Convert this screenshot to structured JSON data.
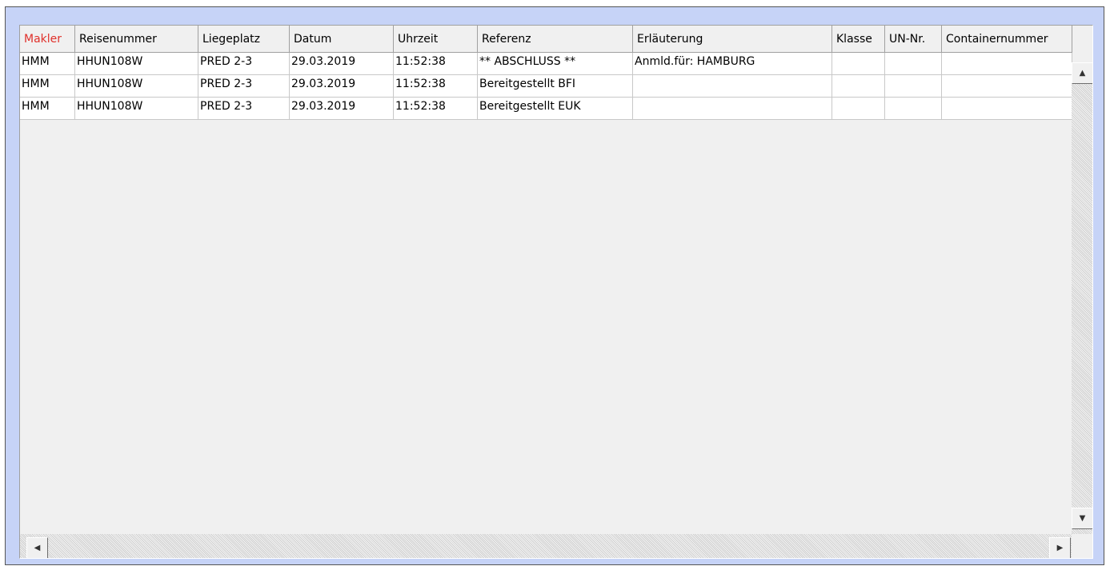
{
  "grid": {
    "columns": [
      "Makler",
      "Reisenummer",
      "Liegeplatz",
      "Datum",
      "Uhrzeit",
      "Referenz",
      "Erläuterung",
      "Klasse",
      "UN-Nr.",
      "Containernummer"
    ],
    "rows": [
      [
        "HMM",
        "HHUN108W",
        "PRED 2-3",
        "29.03.2019",
        "11:52:38",
        "** ABSCHLUSS **",
        "Anmld.für: HAMBURG",
        "",
        "",
        ""
      ],
      [
        "HMM",
        "HHUN108W",
        "PRED 2-3",
        "29.03.2019",
        "11:52:38",
        "Bereitgestellt BFI",
        "",
        "",
        "",
        ""
      ],
      [
        "HMM",
        "HHUN108W",
        "PRED 2-3",
        "29.03.2019",
        "11:52:38",
        "Bereitgestellt EUK",
        "",
        "",
        "",
        ""
      ]
    ],
    "sorted_column_color": "#e0302a"
  },
  "icons": {
    "scroll_up": "▲",
    "scroll_down": "▼",
    "scroll_left": "◀",
    "scroll_right": "▶"
  }
}
